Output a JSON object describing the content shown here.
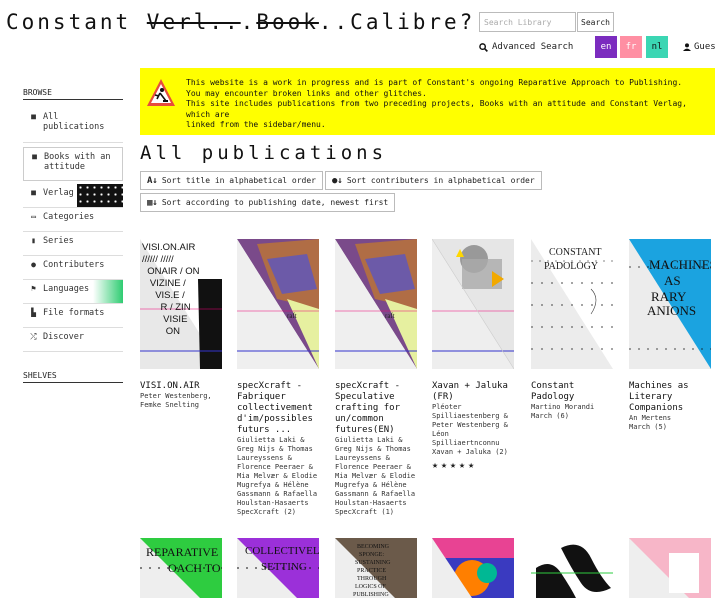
{
  "header": {
    "title_part1": "Constant ",
    "title_strike1": "Verl..",
    "title_dots": ".",
    "title_strike2": "Book",
    "title_part2": "..Calibre?!",
    "search_placeholder": "Search Library",
    "search_button": "Search",
    "advanced_search": "Advanced Search",
    "languages": [
      "en",
      "fr",
      "nl"
    ],
    "guest": "Guest"
  },
  "sidebar": {
    "browse_label": "BROWSE",
    "shelves_label": "SHELVES",
    "items": [
      {
        "label": "All publications",
        "icon": "book-icon"
      },
      {
        "label": "Books with an attitude",
        "icon": "book-icon"
      },
      {
        "label": "Verlag",
        "icon": "book-icon"
      },
      {
        "label": "Categories",
        "icon": "inbox-icon"
      },
      {
        "label": "Series",
        "icon": "bookmark-icon"
      },
      {
        "label": "Contributers",
        "icon": "user-icon"
      },
      {
        "label": "Languages",
        "icon": "flag-icon"
      },
      {
        "label": "File formats",
        "icon": "file-icon"
      },
      {
        "label": "Discover",
        "icon": "shuffle-icon"
      }
    ]
  },
  "banner": {
    "line1": "This website is a work in progress and is part of Constant's ongoing Reparative Approach to Publishing.",
    "line2": "You may encounter broken links and other glitches.",
    "line3": "This site includes publications from two preceding projects, Books with an attitude and Constant Verlag, which are",
    "line4": "linked from the sidebar/menu.",
    "icon": "roadwork-warning-icon",
    "color": "#ffff00"
  },
  "main": {
    "heading": "All publications",
    "sort_title": "Sort title in alphabetical order",
    "sort_contrib": "Sort contributers in alphabetical order",
    "sort_date": "Sort according to publishing date, newest first",
    "books": [
      {
        "title": "VISI.ON.AIR",
        "authors": "Peter Westenberg, Femke Snelting",
        "series": ""
      },
      {
        "title": "specXcraft - Fabriquer collectivement d'im/possibles futurs ...",
        "authors": "Giulietta Laki & Greg Nijs & Thomas Laureyssens & Florence Peeraer & Mia Melvær & Elodie Mugrefya & Hélène Gassmann & Rafaella Houlstan-Hasaerts",
        "series": "SpecXcraft (2)"
      },
      {
        "title": "specXcraft - Speculative crafting for un/common futures(EN)",
        "authors": "Giulietta Laki & Greg Nijs & Thomas Laureyssens & Florence Peeraer & Mia Melvær & Elodie Mugrefya & Hélène Gassmann & Rafaella Houlstan-Hasaerts",
        "series": "SpecXcraft (1)"
      },
      {
        "title": "Xavan + Jaluka (FR)",
        "authors": "Pléoter Spilliaestenberg & Peter Westenberg & Léon Spilliaertnconnu",
        "series": "Xavan + Jaluka (2)",
        "stars": "★★★★★"
      },
      {
        "title": "Constant Padology",
        "authors": "Martino Morandi",
        "series": "March (6)"
      },
      {
        "title": "Machines as Literary Companions",
        "authors": "An Mertens",
        "series": "March (5)"
      }
    ]
  }
}
